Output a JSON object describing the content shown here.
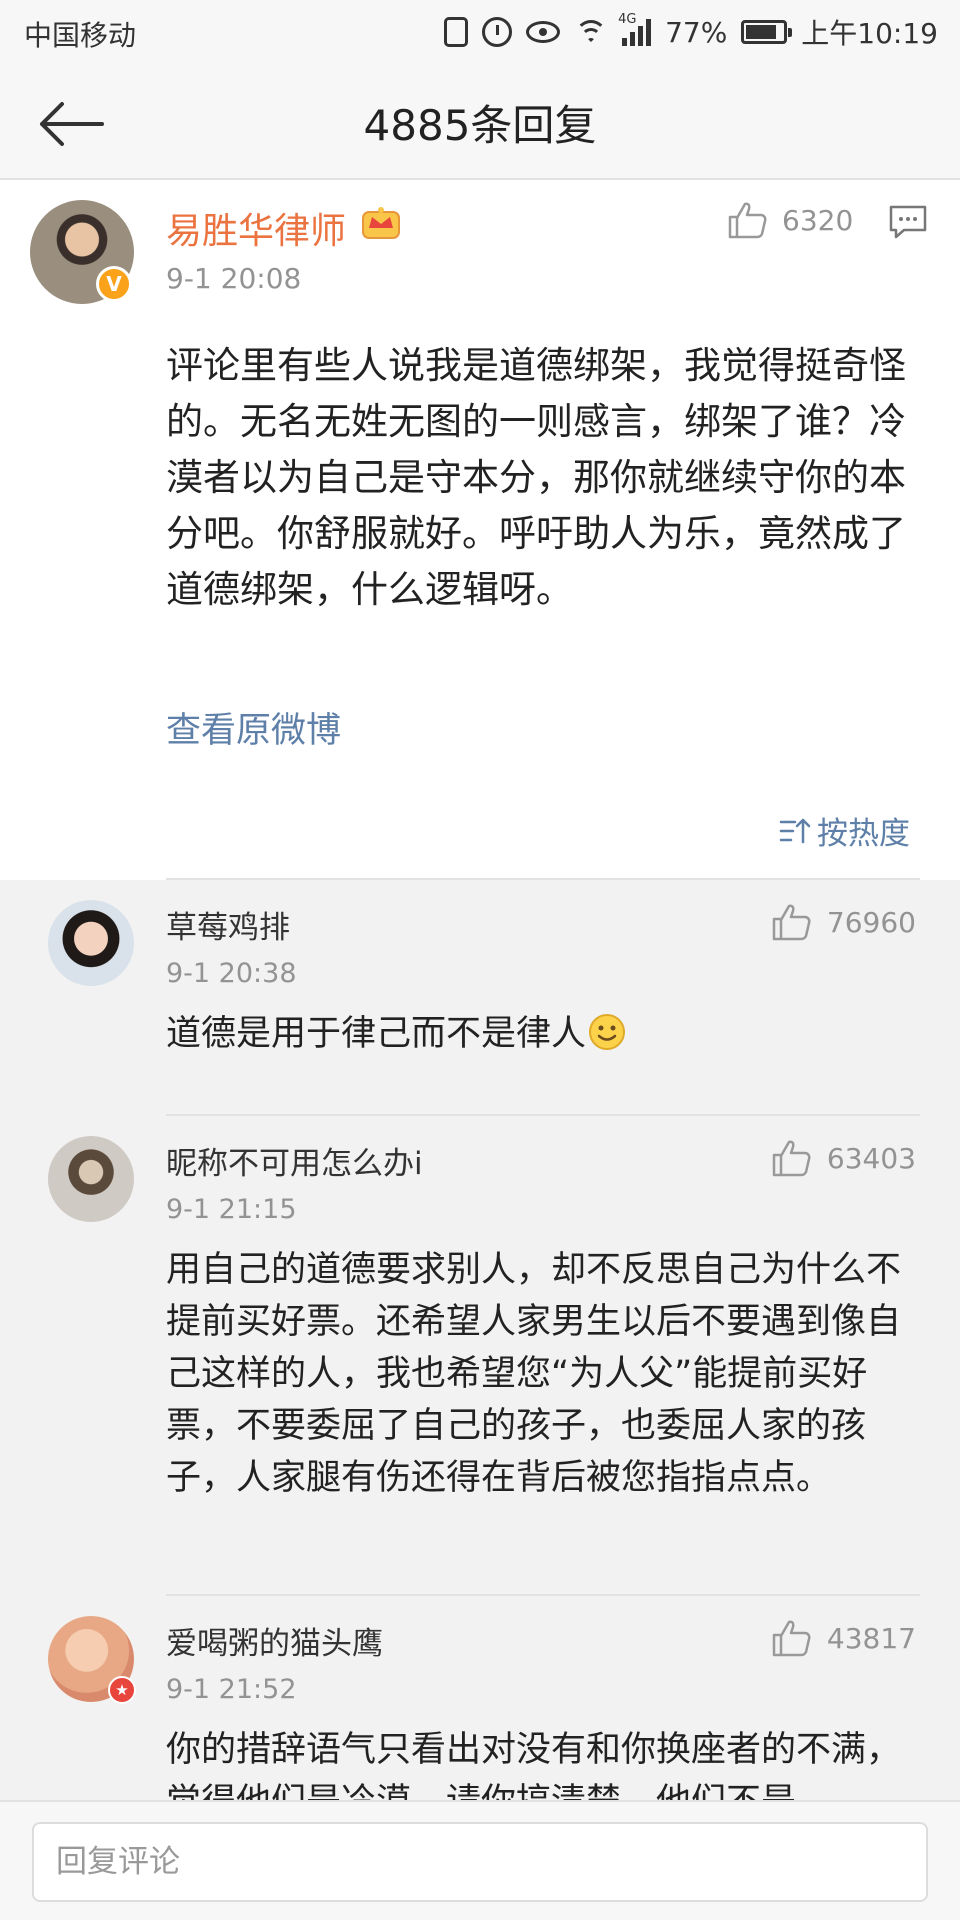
{
  "status_bar": {
    "carrier": "中国移动",
    "network": "4G",
    "battery": "77%",
    "time": "上午10:19"
  },
  "nav": {
    "title": "4885条回复"
  },
  "main_comment": {
    "author": "易胜华律师",
    "time": "9-1 20:08",
    "likes": "6320",
    "text": "评论里有些人说我是道德绑架，我觉得挺奇怪的。无名无姓无图的一则感言，绑架了谁？冷漠者以为自己是守本分，那你就继续守你的本分吧。你舒服就好。呼吁助人为乐，竟然成了道德绑架，什么逻辑呀。",
    "view_original": "查看原微博",
    "sort_label": "按热度"
  },
  "replies": [
    {
      "author": "草莓鸡排",
      "time": "9-1 20:38",
      "likes": "76960",
      "text": "道德是用于律己而不是律人"
    },
    {
      "author": "昵称不可用怎么办i",
      "time": "9-1 21:15",
      "likes": "63403",
      "text": "用自己的道德要求别人，却不反思自己为什么不提前买好票。还希望人家男生以后不要遇到像自己这样的人，我也希望您“为人父”能提前买好票，不要委屈了自己的孩子，也委屈人家的孩子，人家腿有伤还得在背后被您指指点点。"
    },
    {
      "author": "爱喝粥的猫头鹰",
      "time": "9-1 21:52",
      "likes": "43817",
      "text": "你的措辞语气只看出对没有和你换座者的不满，觉得他们是冷漠。请你搞清楚，他们不是"
    }
  ],
  "bottom": {
    "reply_placeholder": "回复评论"
  },
  "colors": {
    "author_orange": "#eb7340",
    "link_blue": "#5d7fa8",
    "meta_gray": "#939393",
    "badge_orange": "#f9a21a",
    "badge_red": "#e8463c"
  }
}
